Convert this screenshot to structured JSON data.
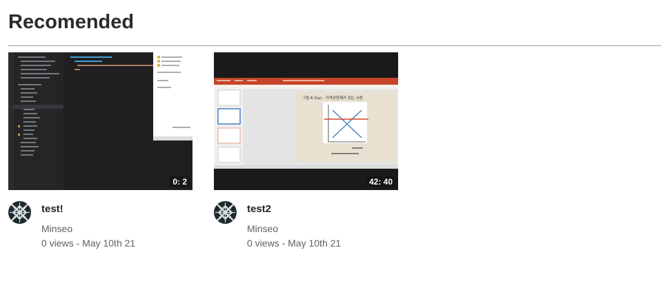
{
  "section": {
    "title": "Recomended"
  },
  "videos": [
    {
      "title": "test!",
      "channel": "Minseo",
      "views": "0 views",
      "separator": " - ",
      "date": "May 10th 21",
      "duration": "0: 2",
      "thumbnail_kind": "code-editor-screen"
    },
    {
      "title": "test2",
      "channel": "Minseo",
      "views": "0 views",
      "separator": " - ",
      "date": "May 10th 21",
      "duration": "42: 40",
      "thumbnail_kind": "presentation-slide-screen",
      "slide_heading": "그림 6.1(a) : 가격상한제가 있는 시장"
    }
  ],
  "colors": {
    "editor_bg": "#1f1f1f",
    "slide_ribbon": "#c6452a",
    "slide_bg": "#e8e0d0",
    "avatar_dark": "#1e2a2e"
  }
}
